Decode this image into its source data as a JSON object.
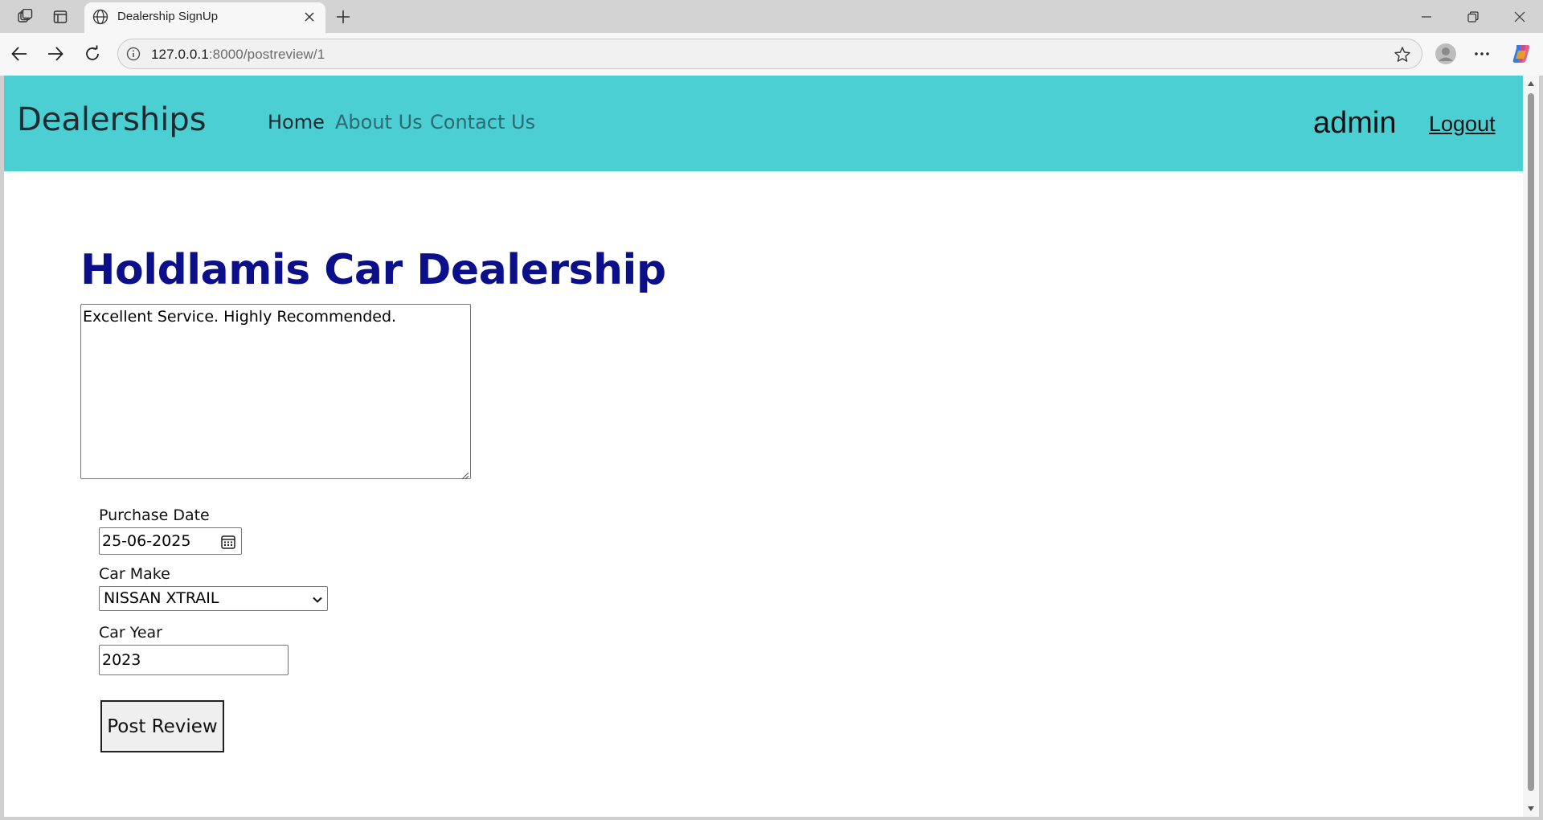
{
  "browser": {
    "tab_title": "Dealership SignUp",
    "url_host": "127.0.0.1",
    "url_rest": ":8000/postreview/1"
  },
  "navbar": {
    "brand": "Dealerships",
    "links": [
      "Home",
      "About Us",
      "Contact Us"
    ],
    "user": "admin",
    "logout": "Logout"
  },
  "main": {
    "title": "Holdlamis Car Dealership",
    "review_text": "Excellent Service. Highly Recommended.",
    "purchase_date_label": "Purchase Date",
    "purchase_date_value": "25-06-2025",
    "car_make_label": "Car Make",
    "car_make_value": "NISSAN XTRAIL",
    "car_year_label": "Car Year",
    "car_year_value": "2023",
    "submit_label": "Post Review"
  },
  "colors": {
    "navbar_bg": "#4ccfd3",
    "title": "#0c0f8a"
  },
  "icons": [
    "workspaces-icon",
    "tab-actions-icon",
    "globe-icon",
    "close-icon",
    "new-tab-icon",
    "minimize-icon",
    "restore-icon",
    "window-close-icon",
    "back-icon",
    "forward-icon",
    "refresh-icon",
    "info-icon",
    "star-icon",
    "profile-icon",
    "more-icon",
    "copilot-icon",
    "calendar-icon",
    "chevron-down-icon"
  ]
}
